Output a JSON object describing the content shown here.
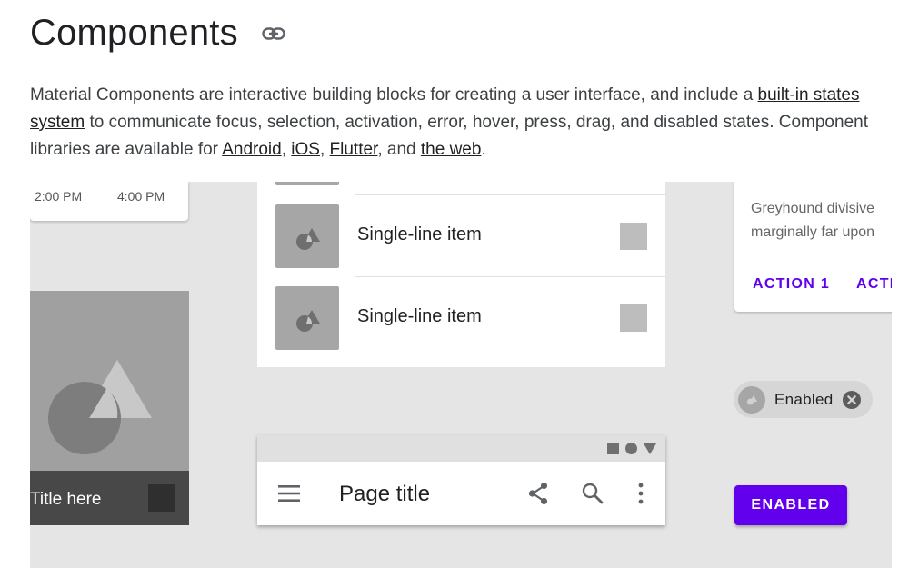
{
  "header": {
    "title": "Components",
    "anchor_icon": "link-icon"
  },
  "intro": {
    "text_1": "Material Components are interactive building blocks for creating a user interface, and include a ",
    "link_states": "built-in states system",
    "text_2": " to communicate focus, selection, activation, error, hover, press, drag, and disabled states. Component libraries are available for ",
    "link_android": "Android",
    "sep_1": ", ",
    "link_ios": "iOS",
    "sep_2": ", ",
    "link_flutter": "Flutter",
    "sep_3": ", and ",
    "link_web": "the web",
    "text_end": "."
  },
  "showcase": {
    "time_picker": {
      "time_1": "2:00 PM",
      "time_2": "4:00 PM"
    },
    "image_tile": {
      "title": "Title here",
      "image_icon": "shapes-icon"
    },
    "list": {
      "items": [
        {
          "label": "Single-line item",
          "icon": "shapes-icon"
        },
        {
          "label": "Single-line item",
          "icon": "shapes-icon"
        }
      ]
    },
    "card": {
      "body_line_1": "Greyhound divisive",
      "body_line_2": "marginally far upon",
      "action_1": "ACTION 1",
      "action_2": "ACTI"
    },
    "chip": {
      "label": "Enabled",
      "close_icon": "cancel-circle-icon"
    },
    "button": {
      "label": "ENABLED"
    },
    "app_bar": {
      "title": "Page title",
      "icons": [
        "menu-icon",
        "share-icon",
        "search-icon",
        "more-vert-icon"
      ]
    }
  },
  "colors": {
    "accent": "#6200ee",
    "showcase_bg": "#e5e5e5",
    "placeholder_gray": "#a6a6a6",
    "tile_bar": "#484848"
  }
}
